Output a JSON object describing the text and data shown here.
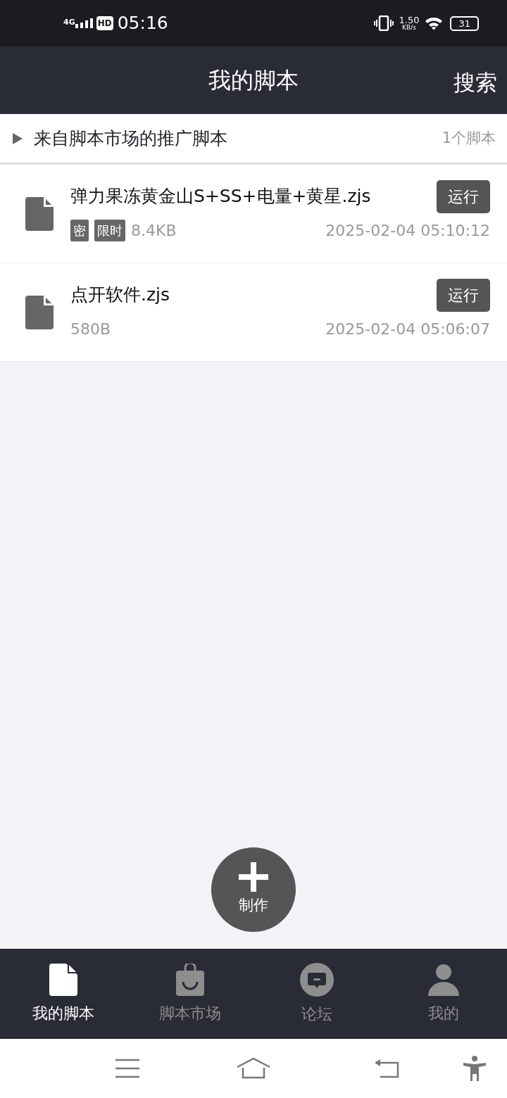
{
  "status_bar": {
    "network": "4G",
    "hd": "HD",
    "time": "05:16",
    "speed_value": "1.50",
    "speed_unit": "KB/s",
    "battery": "31"
  },
  "header": {
    "title": "我的脚本",
    "action": "搜索"
  },
  "promo": {
    "label": "来自脚本市场的推广脚本",
    "count": "1个脚本",
    "expanded": false
  },
  "scripts": [
    {
      "name": "弹力果冻黄金山S+SS+电量+黄星.zjs",
      "tags": [
        "密",
        "限时"
      ],
      "size": "8.4KB",
      "date": "2025-02-04 05:10:12",
      "run_label": "运行"
    },
    {
      "name": "点开软件.zjs",
      "size": "580B",
      "date": "2025-02-04 05:06:07",
      "run_label": "运行"
    }
  ],
  "fab": {
    "label": "制作"
  },
  "tabs": [
    {
      "label": "我的脚本",
      "kind": "script",
      "selected": true
    },
    {
      "label": "脚本市场",
      "kind": "market",
      "selected": false
    },
    {
      "label": "论坛",
      "kind": "forum",
      "selected": false
    },
    {
      "label": "我的",
      "kind": "me",
      "selected": false
    }
  ]
}
